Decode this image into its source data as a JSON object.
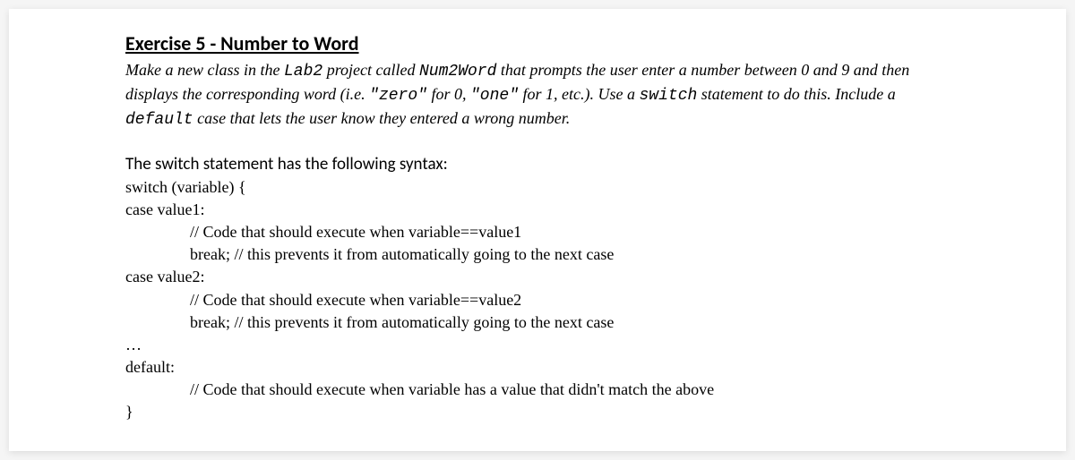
{
  "heading": "Exercise 5 - Number to Word",
  "description": {
    "part1": "Make a new class in the ",
    "lab2": "Lab2",
    "part2": " project called ",
    "num2word": "Num2Word",
    "part3": " that prompts the user enter a number between 0 and 9 and then displays the corresponding word (i.e. ",
    "zero": "\"zero\"",
    "part4": " for 0, ",
    "one": "\"one\"",
    "part5": " for 1, etc.). Use a ",
    "switch": "switch",
    "part6": " statement to do this. Include a ",
    "default": "default",
    "part7": " case that lets the user know they entered a wrong number."
  },
  "syntax_intro": "The switch statement has the following syntax:",
  "code": {
    "line1": "switch (variable) {",
    "line2": "case value1:",
    "line3": "// Code that should execute when variable==value1",
    "line4": "break; // this prevents it from automatically going to the next case",
    "line5": "case value2:",
    "line6": "// Code that should execute when variable==value2",
    "line7": "break; // this prevents it from automatically going to the next case",
    "line8": "…",
    "line9": "default:",
    "line10": "// Code that should execute when variable has a value that didn't match the above",
    "line11": "}"
  }
}
